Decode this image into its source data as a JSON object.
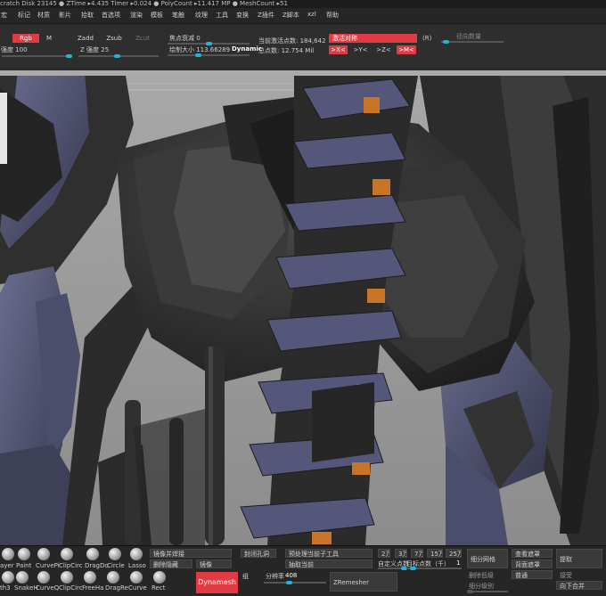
{
  "status": {
    "text": "cratch Disk 23145 ● ZTime ▸4.435 Timer ▸0.024 ● PolyCount ▸11.417 MP ● MeshCount ▸51"
  },
  "menu": [
    "宏",
    "标记",
    "材质",
    "影片",
    "拾取",
    "首选项",
    "渲染",
    "模板",
    "笔触",
    "纹理",
    "工具",
    "变换",
    "Z插件",
    "Z脚本",
    "xzl",
    "帮助"
  ],
  "toolbar": {
    "rgb_label": "Rgb",
    "m_label": "M",
    "rgb_intensity_label": "强度 100",
    "zadd_label": "Zadd",
    "zsub_label": "Zsub",
    "zcut_label": "Zcut",
    "z_intensity_label": "Z 强度 25",
    "focal_shift_label": "焦点衰减 0",
    "draw_size_label": "绘制大小 113.66289",
    "dynamic_label": "Dynamic",
    "active_points_label": "当前激活点数: 184,642",
    "total_points_label": "总点数: 12.754 Mil",
    "activate_symmetry_label": "激活对称",
    "x_axis_label": ">X<",
    "y_axis_label": ">Y<",
    "z_axis_label": ">Z<",
    "m_axis_label": ">M<",
    "r_label": "(R)",
    "rs_label": "径向数量"
  },
  "bottom": {
    "brushes_row1": [
      "ayer",
      "Paint",
      "CurvePi",
      "ClipCirc",
      "DragDo",
      "Circle",
      "Lasso"
    ],
    "brushes_row2": [
      "th3",
      "SnakeH",
      "CurveQ",
      "ClipCirc",
      "FreeHa",
      "DragRe",
      "Curve",
      "Rect"
    ],
    "mirror_weld_label": "镜像并焊接",
    "delete_hidden_label": "删除隐藏",
    "mirror_label": "镜像",
    "close_holes_label": "封闭孔洞",
    "preprocess_label": "预处理当前子工具",
    "extract_current_label": "抽取当前",
    "dynamesh_label": "Dynamesh",
    "group_label": "组",
    "resolution_label": "分辨率",
    "resolution_value": "408",
    "zremesher_label": "ZRemesher",
    "count_2w": "2万",
    "count_3w": "3万",
    "count_7w": "7万",
    "count_15w": "15万",
    "count_25w": "25万",
    "custom_count_label": "自定义点数",
    "target_count_label": "目标点数（千）",
    "target_count_value": "1",
    "subdivide_label": "细分网格",
    "delete_lower_label": "删除低级",
    "subdiv_level_label": "细分级别",
    "view_mask_label": "查看遮罩",
    "invert_mask_label": "背面遮罩",
    "normal_label": "普通",
    "extract_label": "提取",
    "accept_label": "接受",
    "merge_down_label": "向下合并"
  },
  "colors": {
    "accent_red": "#e03a45",
    "slider_blue": "#22b4e0",
    "viewport_bg": "#9a9a9a"
  }
}
